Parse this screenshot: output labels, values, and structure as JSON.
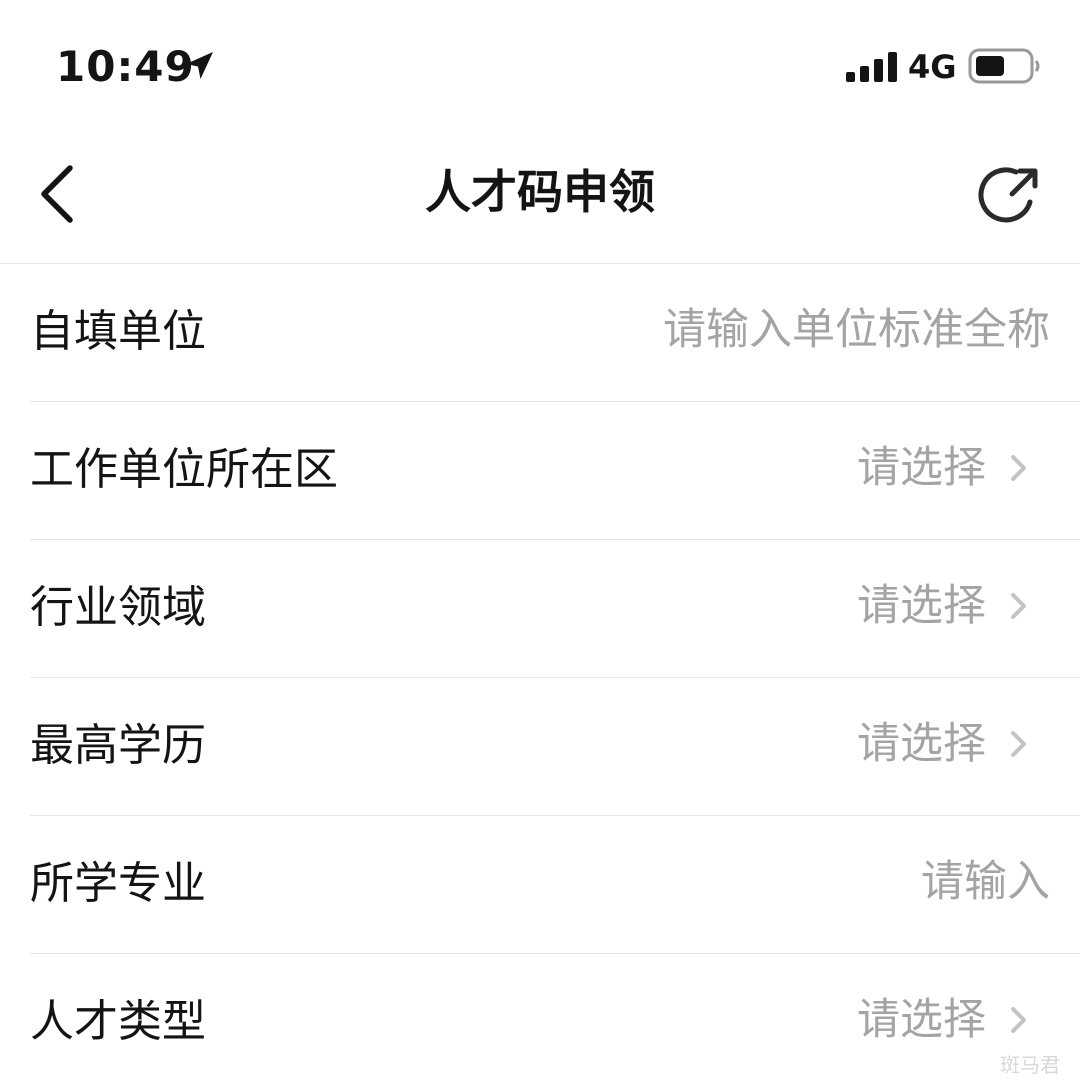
{
  "status_bar": {
    "time": "10:49",
    "network": "4G",
    "icons": [
      "location-arrow-icon",
      "cellular-signal-icon",
      "battery-icon"
    ]
  },
  "nav": {
    "title": "人才码申领",
    "back_icon": "chevron-left-icon",
    "share_icon": "share-icon"
  },
  "form": {
    "rows": [
      {
        "label": "自填单位",
        "type": "input",
        "placeholder": "请输入单位标准全称"
      },
      {
        "label": "工作单位所在区",
        "type": "select",
        "value": "请选择"
      },
      {
        "label": "行业领域",
        "type": "select",
        "value": "请选择"
      },
      {
        "label": "最高学历",
        "type": "select",
        "value": "请选择"
      },
      {
        "label": "所学专业",
        "type": "input",
        "placeholder": "请输入"
      },
      {
        "label": "人才类型",
        "type": "select",
        "value": "请选择"
      }
    ]
  },
  "watermark": "斑马君",
  "colors": {
    "text": "#141414",
    "placeholder": "#a4a4a4",
    "divider": "#e4e4e4",
    "chevron": "#c4c4c4"
  }
}
